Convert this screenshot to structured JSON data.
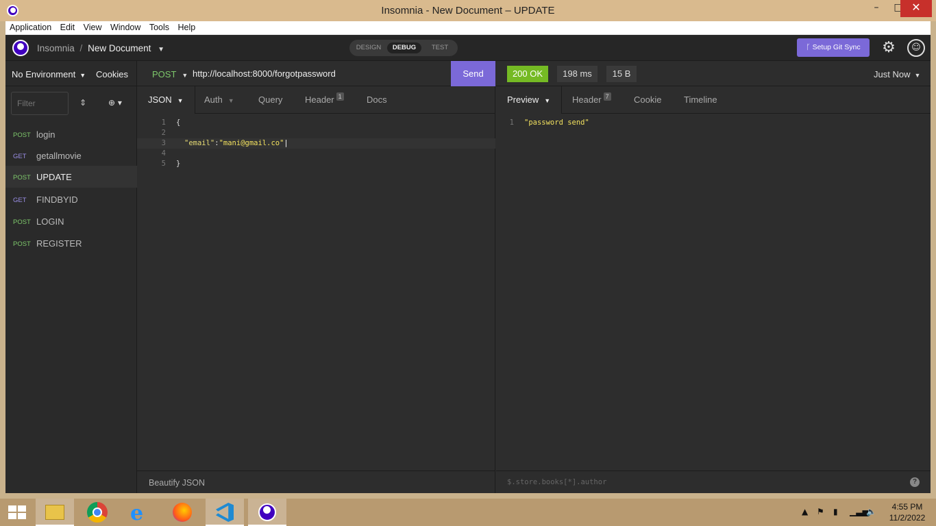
{
  "window": {
    "title": "Insomnia - New Document – UPDATE",
    "minimize": "–",
    "maximize": "□",
    "close": "✕"
  },
  "menu": [
    "Application",
    "Edit",
    "View",
    "Window",
    "Tools",
    "Help"
  ],
  "header": {
    "app_name": "Insomnia",
    "separator": "/",
    "document": "New Document",
    "modes": {
      "design": "DESIGN",
      "debug": "DEBUG",
      "test": "TEST"
    },
    "git_sync": "Setup Git Sync"
  },
  "sidebar": {
    "environment": "No Environment",
    "cookies": "Cookies",
    "filter_placeholder": "Filter",
    "requests": [
      {
        "method": "POST",
        "name": "login"
      },
      {
        "method": "GET",
        "name": "getallmovie"
      },
      {
        "method": "POST",
        "name": "UPDATE",
        "active": true
      },
      {
        "method": "GET",
        "name": "FINDBYID"
      },
      {
        "method": "POST",
        "name": "LOGIN"
      },
      {
        "method": "POST",
        "name": "REGISTER"
      }
    ]
  },
  "request": {
    "method": "POST",
    "url": "http://localhost:8000/forgotpassword",
    "send": "Send",
    "tabs": {
      "json": "JSON",
      "auth": "Auth",
      "query": "Query",
      "header": "Header",
      "header_count": "1",
      "docs": "Docs"
    },
    "body_lines": [
      {
        "num": "1",
        "text": "{"
      },
      {
        "num": "2",
        "text": ""
      },
      {
        "num": "3",
        "key": "\"email\"",
        "colon": ":",
        "value": "\"mani@gmail.co\""
      },
      {
        "num": "4",
        "text": ""
      },
      {
        "num": "5",
        "text": "}"
      }
    ],
    "footer": "Beautify JSON"
  },
  "response": {
    "status": "200 OK",
    "time": "198 ms",
    "size": "15 B",
    "when": "Just Now",
    "tabs": {
      "preview": "Preview",
      "header": "Header",
      "header_count": "7",
      "cookie": "Cookie",
      "timeline": "Timeline"
    },
    "body_lines": [
      {
        "num": "1",
        "text": "\"password send\""
      }
    ],
    "filter_placeholder": "$.store.books[*].author",
    "help": "?"
  },
  "taskbar": {
    "time": "4:55 PM",
    "date": "11/2/2022"
  },
  "colors": {
    "accent": "#7b69d8",
    "post": "#7ec86b",
    "get": "#9b8fe6",
    "ok": "#75ba24"
  }
}
